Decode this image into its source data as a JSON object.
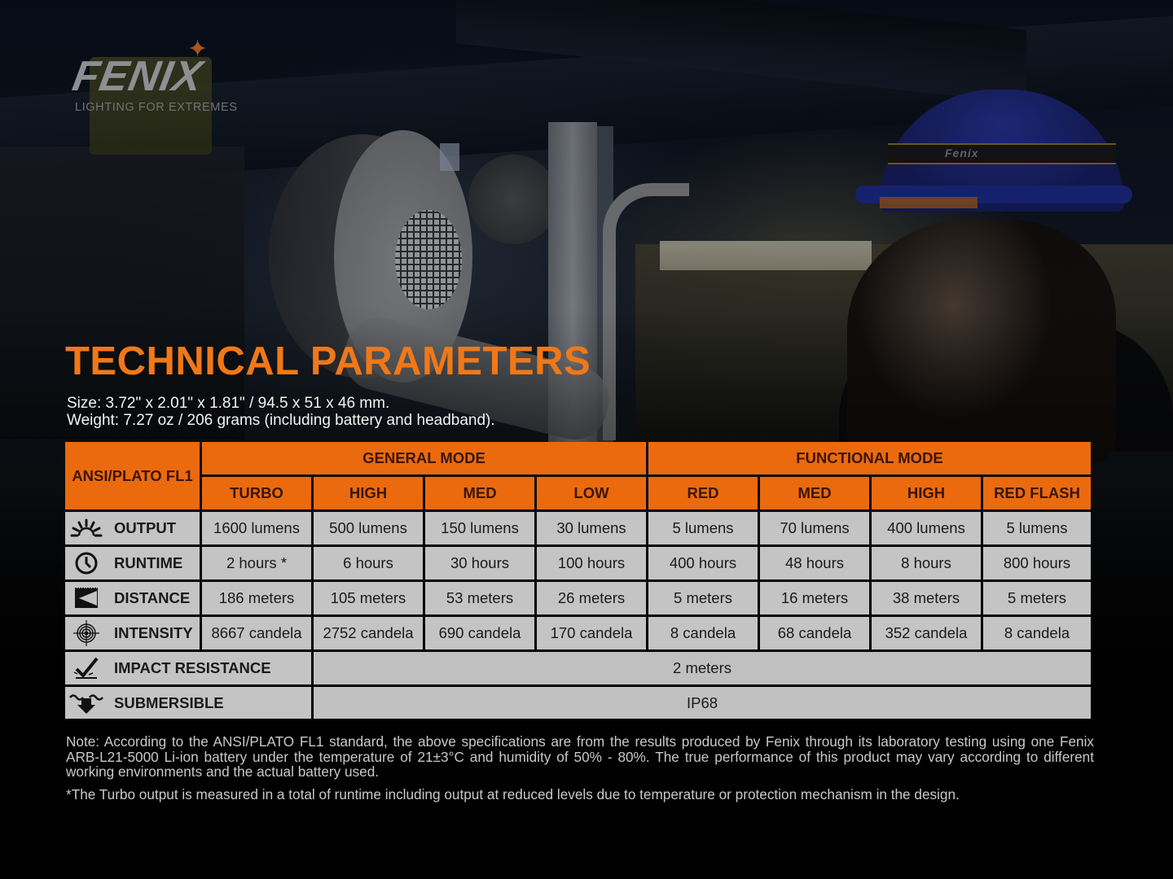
{
  "brand": {
    "logo_text": "FENIX",
    "tagline": "LIGHTING FOR EXTREMES",
    "headband_print": "Fenix"
  },
  "colors": {
    "accent_orange": "#eb6a0e",
    "title_orange": "#f07818",
    "cell_gray": "#c4c4c4",
    "background": "#000000"
  },
  "title": "TECHNICAL PARAMETERS",
  "specs": {
    "size": "Size: 3.72\" x 2.01\" x 1.81\" / 94.5 x 51 x 46 mm.",
    "weight": "Weight: 7.27 oz / 206 grams (including battery and headband)."
  },
  "table": {
    "corner_label": "ANSI/PLATO FL1",
    "groups": [
      {
        "label": "GENERAL MODE",
        "modes": [
          "TURBO",
          "HIGH",
          "MED",
          "LOW"
        ]
      },
      {
        "label": "FUNCTIONAL MODE",
        "modes": [
          "RED",
          "MED",
          "HIGH",
          "RED FLASH"
        ]
      }
    ],
    "rows": [
      {
        "label": "OUTPUT",
        "icon": "output-sunburst-icon",
        "values": [
          "1600 lumens",
          "500 lumens",
          "150 lumens",
          "30 lumens",
          "5 lumens",
          "70 lumens",
          "400 lumens",
          "5 lumens"
        ]
      },
      {
        "label": "RUNTIME",
        "icon": "clock-icon",
        "values": [
          "2 hours *",
          "6 hours",
          "30 hours",
          "100 hours",
          "400 hours",
          "48 hours",
          "8 hours",
          "800 hours"
        ]
      },
      {
        "label": "DISTANCE",
        "icon": "beam-distance-icon",
        "values": [
          "186 meters",
          "105 meters",
          "53 meters",
          "26 meters",
          "5 meters",
          "16 meters",
          "38 meters",
          "5 meters"
        ]
      },
      {
        "label": "INTENSITY",
        "icon": "target-icon",
        "values": [
          "8667 candela",
          "2752 candela",
          "690 candela",
          "170 candela",
          "8 candela",
          "68 candela",
          "352 candela",
          "8 candela"
        ]
      }
    ],
    "span_rows": [
      {
        "label": "IMPACT RESISTANCE",
        "icon": "impact-check-icon",
        "value": "2 meters"
      },
      {
        "label": "SUBMERSIBLE",
        "icon": "submersible-arrow-icon",
        "value": "IP68"
      }
    ]
  },
  "notes": {
    "main": "Note: According to the ANSI/PLATO FL1 standard, the above specifications are from the results produced by Fenix through its laboratory testing using one Fenix ARB-L21-5000 Li-ion battery under the temperature of 21±3°C and humidity of 50% - 80%. The true performance of this product may vary according to different working environments and the actual battery used.",
    "footnote": "*The Turbo output is measured in a total of runtime including output at reduced levels due to temperature or protection mechanism in the design."
  }
}
